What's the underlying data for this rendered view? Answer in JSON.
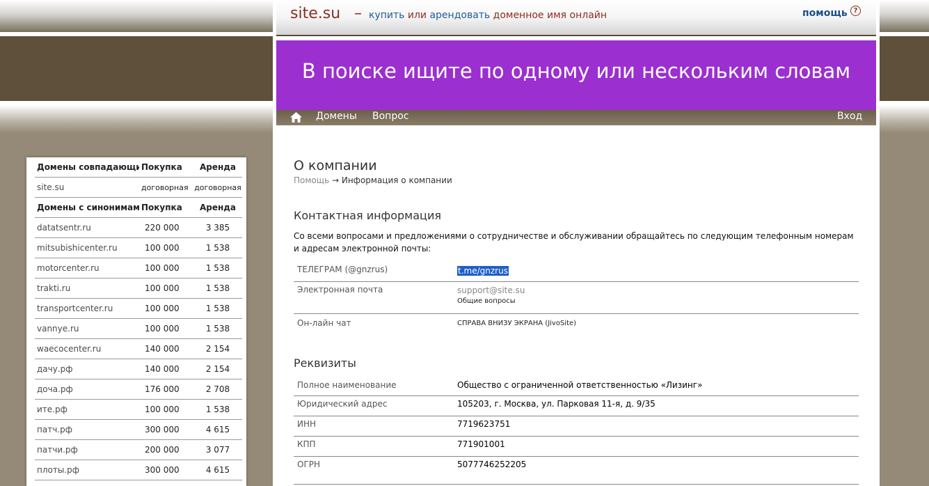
{
  "header": {
    "logo": "site.su",
    "dash": "–",
    "tagline_buy": "купить",
    "tagline_or": "или",
    "tagline_rent": "арендовать",
    "tagline_rest": "доменное имя онлайн",
    "help_label": "помощь",
    "help_icon": "?"
  },
  "banner": {
    "text": "В поиске ищите по одному или нескольким словам"
  },
  "nav": {
    "home_icon": "home-icon",
    "domains": "Домены",
    "question": "Вопрос",
    "login": "Вход"
  },
  "page": {
    "title": "О компании",
    "breadcrumb_home": "Помощь",
    "breadcrumb_arrow": "→",
    "breadcrumb_current": "Информация о компании"
  },
  "contacts": {
    "heading": "Контактная информация",
    "intro": "Со всеми вопросами и предложениями о сотрудничестве и обслуживании обращайтесь по следующим телефонным номерам и адресам электронной почты:",
    "telegram_label": "ТЕЛЕГРАМ (@gnzrus)",
    "telegram_link": "t.me/gnzrus",
    "email_label": "Электронная почта",
    "email_value": "support@site.su",
    "email_note": "Общие вопросы",
    "chat_label": "Он-лайн чат",
    "chat_value": "СПРАВА ВНИЗУ ЭКРАНА (JivoSite)"
  },
  "requisites": {
    "heading": "Реквизиты",
    "rows": [
      {
        "label": "Полное наименование",
        "value": "Общество с ограниченной ответственностью «Лизинг»"
      },
      {
        "label": "Юридический адрес",
        "value": "105203, г. Москва, ул. Парковая 11-я, д. 9/35"
      },
      {
        "label": "ИНН",
        "value": "7719623751"
      },
      {
        "label": "КПП",
        "value": "771901001"
      },
      {
        "label": "ОГРН",
        "value": "5077746252205"
      }
    ]
  },
  "sidebar": {
    "header1": {
      "c1": "Домены совпадающие",
      "c2": "Покупка",
      "c3": "Аренда"
    },
    "exact": [
      {
        "name": "site.su",
        "buy": "договорная",
        "rent": "договорная"
      }
    ],
    "header2": {
      "c1": "Домены с синонимами",
      "c2": "Покупка",
      "c3": "Аренда"
    },
    "synonyms": [
      {
        "name": "datatsentr.ru",
        "buy": "220 000",
        "rent": "3 385"
      },
      {
        "name": "mitsubishicenter.ru",
        "buy": "100 000",
        "rent": "1 538"
      },
      {
        "name": "motorcenter.ru",
        "buy": "100 000",
        "rent": "1 538"
      },
      {
        "name": "trakti.ru",
        "buy": "100 000",
        "rent": "1 538"
      },
      {
        "name": "transportcenter.ru",
        "buy": "100 000",
        "rent": "1 538"
      },
      {
        "name": "vannye.ru",
        "buy": "100 000",
        "rent": "1 538"
      },
      {
        "name": "waecocenter.ru",
        "buy": "140 000",
        "rent": "2 154"
      },
      {
        "name": "дачу.рф",
        "buy": "140 000",
        "rent": "2 154"
      },
      {
        "name": "доча.рф",
        "buy": "176 000",
        "rent": "2 708"
      },
      {
        "name": "ите.рф",
        "buy": "100 000",
        "rent": "1 538"
      },
      {
        "name": "патч.рф",
        "buy": "300 000",
        "rent": "4 615"
      },
      {
        "name": "патчи.рф",
        "buy": "200 000",
        "rent": "3 077"
      },
      {
        "name": "плоты.рф",
        "buy": "300 000",
        "rent": "4 615"
      }
    ]
  }
}
